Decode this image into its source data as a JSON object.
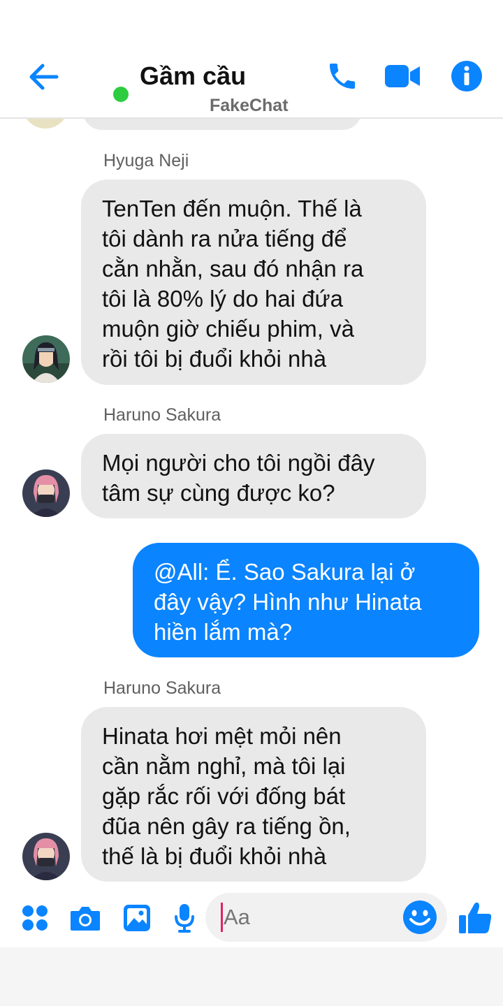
{
  "header": {
    "title": "Gầm cầu",
    "subtitle": "FakeChat"
  },
  "messages": [
    {
      "sender": "Hyuga Neji",
      "lines": [
        "TenTen đến muộn. Thế là",
        "tôi dành ra nửa tiếng để",
        "cằn nhằn, sau đó nhận ra",
        "tôi là 80% lý do hai đứa",
        "muộn giờ chiếu phim, và",
        "rồi tôi bị đuổi khỏi nhà"
      ]
    },
    {
      "sender": "Haruno Sakura",
      "lines": [
        "Mọi người cho tôi ngồi đây",
        "tâm sự cùng được ko?"
      ]
    },
    {
      "sender": "",
      "lines": [
        "@All: Ể. Sao Sakura lại ở",
        "đây vậy? Hình như Hinata",
        "hiền lắm mà?"
      ]
    },
    {
      "sender": "Haruno Sakura",
      "lines": [
        "Hinata hơi mệt mỏi nên",
        "cần nằm nghỉ, mà tôi lại",
        "gặp rắc rối với đống bát",
        "đũa nên gây ra tiếng ồn,",
        "thế là bị đuổi khỏi nhà"
      ]
    }
  ],
  "composer": {
    "placeholder": "Aa"
  },
  "colors": {
    "accent": "#0a84ff",
    "incoming_bubble": "#e9e9e9",
    "online": "#2ecc40"
  },
  "icons": {
    "back": "back-arrow-icon",
    "call": "phone-icon",
    "video": "video-camera-icon",
    "info": "info-icon",
    "apps": "apps-grid-icon",
    "camera": "camera-icon",
    "image": "image-icon",
    "mic": "microphone-icon",
    "emoji": "smiley-icon",
    "like": "thumbs-up-icon"
  }
}
